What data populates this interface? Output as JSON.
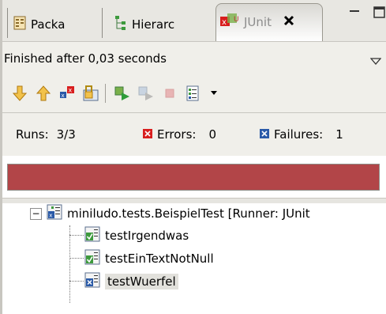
{
  "tabs": [
    {
      "label": "Packa",
      "icon": "package-explorer-icon"
    },
    {
      "label": "Hierarc",
      "icon": "type-hierarchy-icon"
    },
    {
      "label": "JUnit",
      "icon": "junit-icon",
      "active": true
    }
  ],
  "status": {
    "text": "Finished after 0,03 seconds"
  },
  "toolbar": {
    "buttons": [
      "next-failure-icon",
      "previous-failure-icon",
      "show-failures-only-icon",
      "scroll-lock-icon",
      "rerun-test-icon",
      "rerun-failed-first-icon",
      "stop-icon",
      "test-run-history-icon"
    ]
  },
  "counters": {
    "runs_label": "Runs:",
    "runs_value": "3/3",
    "errors_label": "Errors:",
    "errors_value": "0",
    "failures_label": "Failures:",
    "failures_value": "1"
  },
  "progress": {
    "fraction": 1.0,
    "color": "#b24548"
  },
  "tree": {
    "root": "miniludo.tests.BeispielTest [Runner: JUnit",
    "children": [
      {
        "label": "testIrgendwas",
        "status": "passed"
      },
      {
        "label": "testEinTextNotNull",
        "status": "passed"
      },
      {
        "label": "testWuerfel",
        "status": "failed",
        "selected": true
      }
    ]
  }
}
